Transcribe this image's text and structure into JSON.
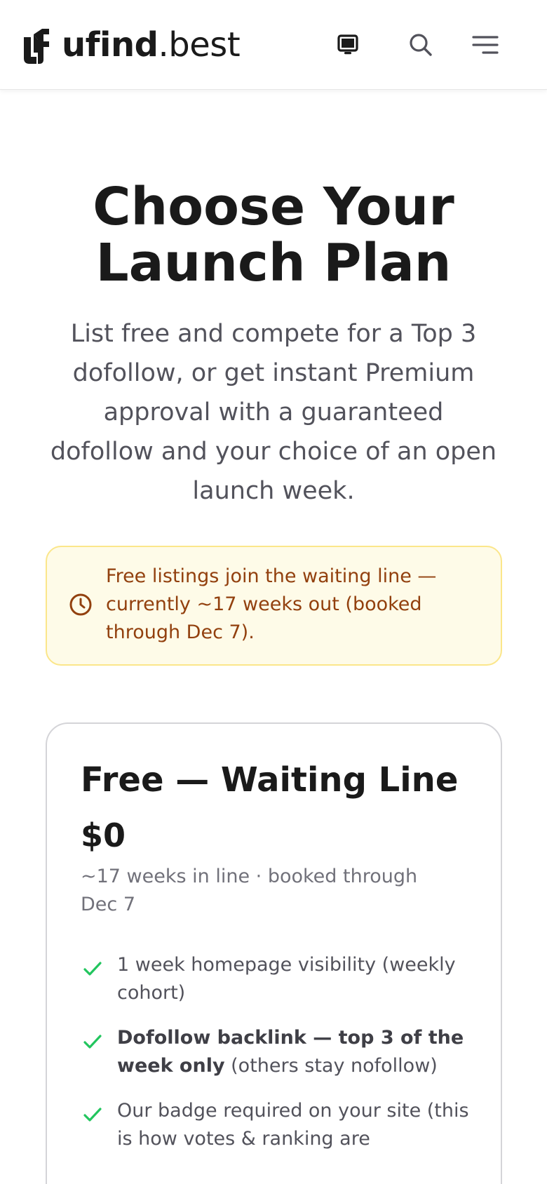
{
  "brand": {
    "name_bold": "ufind",
    "name_light": ".best"
  },
  "header": {
    "icons": [
      "monitor-icon",
      "search-icon",
      "menu-icon"
    ]
  },
  "hero": {
    "title": "Choose Your Launch Plan",
    "subtitle": "List free and compete for a Top 3 dofollow, or get instant Premium approval with a guaranteed dofollow and your choice of an open launch week."
  },
  "notice": {
    "icon": "clock-icon",
    "text": "Free listings join the waiting line — currently ~17 weeks out (booked through Dec 7)."
  },
  "plan": {
    "name": "Free — Waiting Line",
    "price": "$0",
    "meta": "~17 weeks in line · booked through Dec 7",
    "features": [
      {
        "strong": "",
        "text": "1 week homepage visibility (weekly cohort)"
      },
      {
        "strong": "Dofollow backlink — top 3 of the week only",
        "text": " (others stay nofollow)"
      },
      {
        "strong": "",
        "text": "Our badge required on your site (this is how votes & ranking are"
      }
    ]
  },
  "colors": {
    "text": "#1a1a1a",
    "muted": "#52525b",
    "notice_bg": "#fefbe8",
    "notice_border": "#fbe68a",
    "notice_text": "#92400e",
    "check": "#22c55e"
  }
}
